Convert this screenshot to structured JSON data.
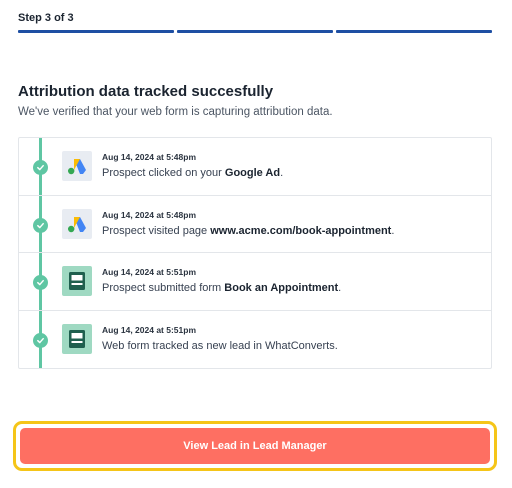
{
  "step": {
    "label": "Step 3 of 3",
    "segments": 3
  },
  "heading": {
    "title": "Attribution data tracked succesfully",
    "subtitle": "We've verified that your web form is capturing attribution data."
  },
  "events": [
    {
      "icon": "google-ads-icon",
      "time": "Aug 14, 2024 at 5:48pm",
      "prefix": "Prospect clicked on your ",
      "highlight": "Google Ad",
      "suffix": "."
    },
    {
      "icon": "google-ads-icon",
      "time": "Aug 14, 2024 at 5:48pm",
      "prefix": "Prospect visited page ",
      "highlight": "www.acme.com/book-appointment",
      "suffix": "."
    },
    {
      "icon": "form-icon",
      "time": "Aug 14, 2024 at 5:51pm",
      "prefix": "Prospect submitted form ",
      "highlight": "Book an Appointment",
      "suffix": "."
    },
    {
      "icon": "form-icon",
      "time": "Aug 14, 2024 at 5:51pm",
      "prefix": "Web form tracked as new lead in WhatConverts.",
      "highlight": "",
      "suffix": ""
    }
  ],
  "cta": {
    "label": "View Lead in Lead Manager"
  },
  "colors": {
    "accent": "#1e4fa3",
    "success": "#5fc6a3",
    "cta": "#fe6f62",
    "focus_ring": "#f5c518"
  }
}
